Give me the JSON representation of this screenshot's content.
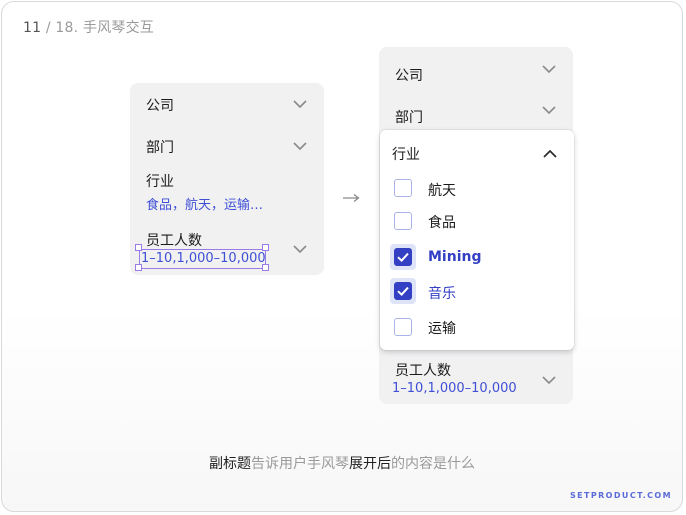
{
  "header": {
    "page_num": "11",
    "sep_total": " / 18.",
    "title": " 手风琴交互"
  },
  "left_panel": {
    "company": "公司",
    "department": "部门",
    "industry_label": "行业",
    "industry_value": "食品，航天，运输…",
    "employees_label": "员工人数",
    "employees_value": "1–10,1,000–10,000"
  },
  "right_panel": {
    "company": "公司",
    "department": "部门",
    "employees_label": "员工人数",
    "employees_value": "1–10,1,000–10,000"
  },
  "dropdown": {
    "title": "行业",
    "options": [
      {
        "label": "航天",
        "checked": false
      },
      {
        "label": "食品",
        "checked": false
      },
      {
        "label": "Mining",
        "checked": true
      },
      {
        "label": "音乐",
        "checked": true
      },
      {
        "label": "运输",
        "checked": false
      }
    ]
  },
  "caption": {
    "part1": "副标题",
    "part2": "告诉用户手风琴",
    "part3": "展开后",
    "part4": "的内容是什么"
  },
  "brand": "SETPRODUCT.COM",
  "colors": {
    "accent": "#3440c4",
    "link_text": "#3f4fd6",
    "panel_bg": "#f1f1f2"
  }
}
